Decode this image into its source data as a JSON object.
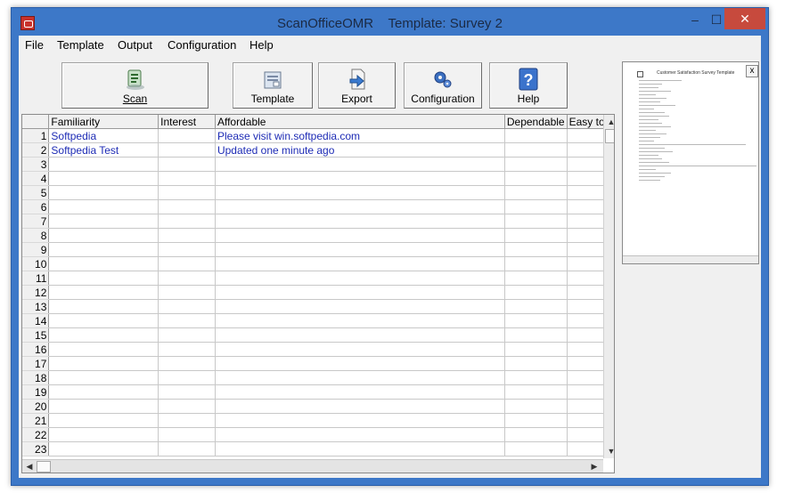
{
  "window": {
    "app_name": "ScanOfficeOMR",
    "template_label": "Template: Survey 2",
    "minimize_symbol": "–",
    "maximize_symbol": "☐",
    "close_symbol": "✕"
  },
  "menu": [
    "File",
    "Template",
    "Output",
    "Configuration",
    "Help"
  ],
  "toolbar": {
    "scan": "Scan",
    "template": "Template",
    "export": "Export",
    "configuration": "Configuration",
    "help": "Help"
  },
  "grid": {
    "columns": [
      "Familiarity",
      "Interest",
      "Affordable",
      "Dependable",
      "Easy to r"
    ],
    "row_numbers": [
      "1",
      "2",
      "3",
      "4",
      "5",
      "6",
      "7",
      "8",
      "9",
      "10",
      "11",
      "12",
      "13",
      "14",
      "15",
      "16",
      "17",
      "18",
      "19",
      "20",
      "21",
      "22",
      "23"
    ],
    "rows": [
      {
        "familiarity": "Softpedia",
        "interest": "",
        "affordable": "Please visit win.softpedia.com",
        "dependable": "",
        "easy": ""
      },
      {
        "familiarity": "Softpedia Test",
        "interest": "",
        "affordable": "Updated one minute ago",
        "dependable": "",
        "easy": ""
      }
    ],
    "scroll_up": "▲",
    "scroll_down": "▼",
    "scroll_left": "◀",
    "scroll_right": "▶"
  },
  "preview": {
    "title": "Customer Satisfaction Survey Template",
    "close_symbol": "x"
  },
  "icons": {
    "scan": "scanner-icon",
    "template": "template-document-icon",
    "export": "export-arrow-icon",
    "configuration": "gears-icon",
    "help": "question-mark-icon"
  },
  "colors": {
    "title_bar": "#3d78c8",
    "close_button": "#c74a3d",
    "cell_text": "#1d2bb5"
  }
}
